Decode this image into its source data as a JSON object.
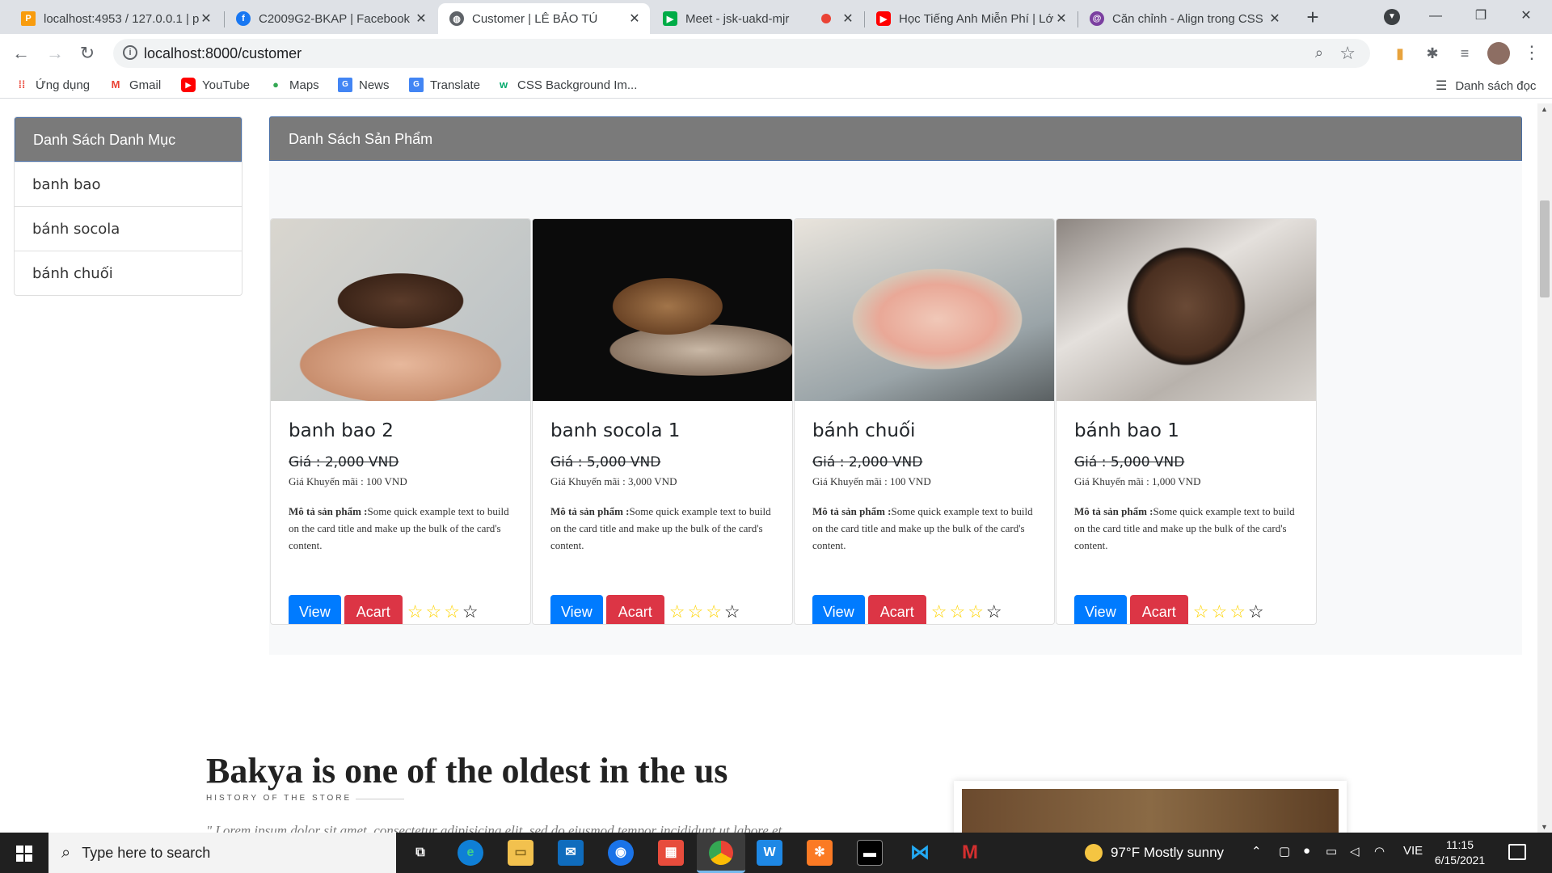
{
  "browser": {
    "tabs": [
      {
        "title": "localhost:4953 / 127.0.0.1 | p",
        "favicon": "phpmyadmin-icon",
        "active": false
      },
      {
        "title": "C2009G2-BKAP | Facebook",
        "favicon": "facebook-icon",
        "active": false
      },
      {
        "title": "Customer | LÊ BẢO TÚ",
        "favicon": "globe-icon",
        "active": true
      },
      {
        "title": "Meet - jsk-uakd-mjr",
        "favicon": "google-meet-icon",
        "active": false
      },
      {
        "title": "Học Tiếng Anh Miễn Phí | Lớ",
        "favicon": "youtube-icon",
        "active": false
      },
      {
        "title": "Căn chỉnh - Align trong CSS",
        "favicon": "site-icon",
        "active": false
      }
    ],
    "url": "localhost:8000/customer",
    "bookmarks": [
      {
        "label": "Ứng dụng",
        "icon": "apps-grid-icon"
      },
      {
        "label": "Gmail",
        "icon": "gmail-icon"
      },
      {
        "label": "YouTube",
        "icon": "youtube-icon"
      },
      {
        "label": "Maps",
        "icon": "maps-pin-icon"
      },
      {
        "label": "News",
        "icon": "news-icon"
      },
      {
        "label": "Translate",
        "icon": "translate-icon"
      },
      {
        "label": "CSS Background Im...",
        "icon": "w3schools-icon"
      }
    ],
    "reading_list": "Danh sách đọc"
  },
  "sidebar": {
    "title": "Danh Sách Danh Mục",
    "items": [
      "banh bao",
      "bánh socola",
      "bánh chuối"
    ]
  },
  "products": {
    "title": "Danh Sách Sản Phẩm",
    "items": [
      {
        "name": "banh bao 2",
        "price": "Giá : 2,000 VND",
        "sale": "Giá Khuyến mãi : 100 VND",
        "desc_label": "Mô tả sản phẩm :",
        "desc": "Some quick example text to build on the card title and make up the bulk of the card's content.",
        "view": "View",
        "cart": "Acart",
        "rating": 3,
        "image": "muffins-photo"
      },
      {
        "name": "banh socola 1",
        "price": "Giá : 5,000 VND",
        "sale": "Giá Khuyến mãi : 3,000 VND",
        "desc_label": "Mô tả sản phẩm :",
        "desc": "Some quick example text to build on the card title and make up the bulk of the card's content.",
        "view": "View",
        "cart": "Acart",
        "rating": 3,
        "image": "bread-loaf-photo"
      },
      {
        "name": "bánh chuối",
        "price": "Giá : 2,000 VND",
        "sale": "Giá Khuyến mãi : 100 VND",
        "desc_label": "Mô tả sản phẩm :",
        "desc": "Some quick example text to build on the card title and make up the bulk of the card's content.",
        "view": "View",
        "cart": "Acart",
        "rating": 3,
        "image": "macarons-photo"
      },
      {
        "name": "bánh bao 1",
        "price": "Giá : 5,000 VND",
        "sale": "Giá Khuyến mãi : 1,000 VND",
        "desc_label": "Mô tả sản phẩm :",
        "desc": "Some quick example text to build on the card title and make up the bulk of the card's content.",
        "view": "View",
        "cart": "Acart",
        "rating": 3,
        "image": "round-bread-photo"
      }
    ]
  },
  "about": {
    "title": "Bakya is one of the oldest in the us",
    "subtitle": "HISTORY OF THE STORE",
    "quote": "\" Lorem ipsum dolor sit amet, consectetur adipisicing elit, sed do eiusmod tempor incididunt ut labore et"
  },
  "taskbar": {
    "search_placeholder": "Type here to search",
    "weather": "97°F  Mostly sunny",
    "language": "VIE",
    "time": "11:15",
    "date": "6/15/2021"
  },
  "colors": {
    "primary_button": "#007bff",
    "danger_button": "#dc3545",
    "panel_header": "#7a7a7a",
    "star": "#ffd400"
  }
}
